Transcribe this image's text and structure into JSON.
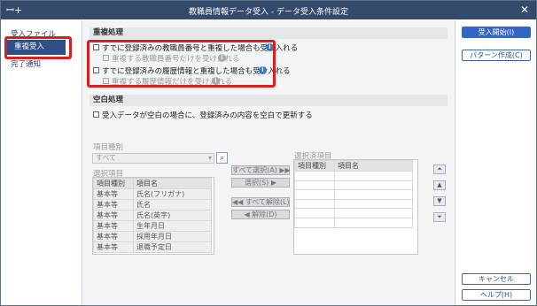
{
  "window": {
    "title": "教職員情報データ受入 - データ受入条件設定",
    "close_glyph": "✕",
    "logo_glyph": "ꟷ+"
  },
  "sidebar": {
    "items": [
      {
        "label": "受入ファイル",
        "active": false
      },
      {
        "label": "重複受入",
        "active": true
      },
      {
        "label": "完了通知",
        "active": false
      }
    ]
  },
  "duplicate_section": {
    "heading": "重複処理",
    "options": [
      {
        "label": "すでに登録済みの教職員番号と重複した場合も受け入れる",
        "checked": false,
        "enabled": true
      },
      {
        "label": "重複する教職員番号だけを受け入れる",
        "checked": false,
        "enabled": false
      },
      {
        "label": "すでに登録済みの履歴情報と重複した場合も受け入れる",
        "checked": false,
        "enabled": true
      },
      {
        "label": "重複する履歴情報だけを受け入れる",
        "checked": false,
        "enabled": false
      }
    ]
  },
  "blank_section": {
    "heading": "空白処理",
    "option": {
      "label": "受入データが空白の場合に、登録済みの内容を空白で更新する",
      "checked": false
    },
    "item_type_label": "項目種別",
    "item_type_value": "すべて",
    "source_list": {
      "title": "選択項目",
      "columns": [
        "項目種別",
        "項目名"
      ],
      "rows": [
        [
          "基本等",
          "氏名(フリガナ)"
        ],
        [
          "基本等",
          "氏名"
        ],
        [
          "基本等",
          "氏名(英字)"
        ],
        [
          "基本等",
          "生年月日"
        ],
        [
          "基本等",
          "採用年月日"
        ],
        [
          "基本等",
          "退職予定日"
        ]
      ]
    },
    "target_list": {
      "title": "選択済項目",
      "columns": [
        "項目種別",
        "項目名"
      ],
      "empty_rows": 6
    },
    "transfer_buttons": {
      "select_all": "すべて選択(A) ▶▶",
      "select": "選択(S) ▶",
      "deselect_all": "◀◀ すべて解除(L)",
      "deselect": "◀ 解除(D)"
    },
    "order_buttons": [
      "⏶",
      "▲",
      "▼",
      "⏷"
    ]
  },
  "actions": {
    "start_import": "受入開始(I)",
    "pattern_create": "パターン作成(C)",
    "cancel": "キャンセル",
    "help": "ヘルプ(H)"
  },
  "colors": {
    "titlebar": "#344a6b",
    "sidebar_active": "#2f4f8a",
    "highlight": "#d92020",
    "primary_button": "#3165c8",
    "info_icon": "#2d7ad6"
  }
}
